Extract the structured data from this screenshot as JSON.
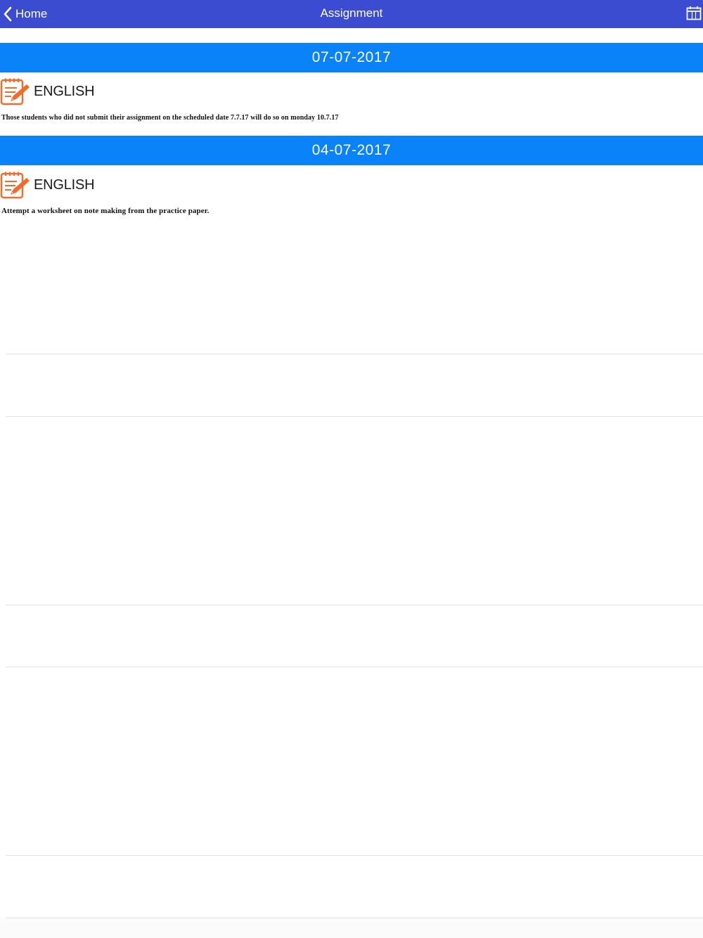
{
  "navbar": {
    "back_label": "Home",
    "title": "Assignment",
    "background": "#3b4cd1",
    "calendar_icon": "calendar-icon"
  },
  "sections": [
    {
      "date": "07-07-2017",
      "subject": "ENGLISH",
      "text": "Those students who did not submit their assignment on the   scheduled date  7.7.17 will do so on monday 10.7.17"
    },
    {
      "date": "04-07-2017",
      "subject": "ENGLISH",
      "text": "Attempt a worksheet on note making from the practice paper."
    }
  ],
  "colors": {
    "section_header": "#0a82f8",
    "subject_icon": "#f26b2a",
    "divider": "#e2e2e2"
  }
}
